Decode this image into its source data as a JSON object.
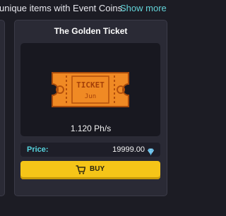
{
  "header": {
    "text": "unique items with Event Coins.",
    "show_more_label": "Show more"
  },
  "item": {
    "title": "The Golden Ticket",
    "image_text_top": "TICKET",
    "image_text_bottom": "Jun",
    "hashrate": "1.120 Ph/s",
    "price_label": "Price:",
    "price_value": "19999.00",
    "buy_label": "BUY",
    "icons": {
      "gem": "diamond-icon",
      "cart": "cart-icon"
    }
  },
  "colors": {
    "accent": "#63d3d8",
    "buy_button": "#f5c518",
    "ticket": "#f08a24"
  }
}
